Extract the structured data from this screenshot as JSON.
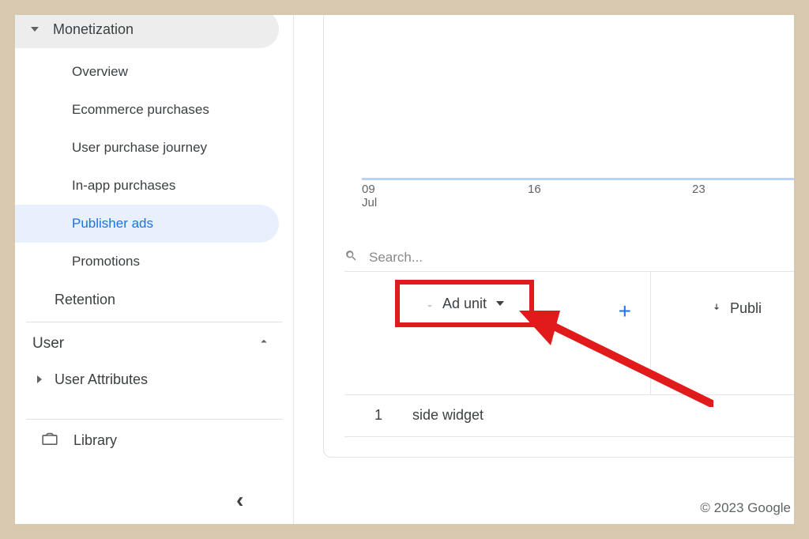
{
  "sidebar": {
    "section_title": "Monetization",
    "items": [
      "Overview",
      "Ecommerce purchases",
      "User purchase journey",
      "In-app purchases",
      "Publisher ads",
      "Promotions"
    ],
    "active_index": 4,
    "retention_label": "Retention",
    "user_label": "User",
    "user_attributes_label": "User Attributes",
    "library_label": "Library"
  },
  "chart_data": {
    "type": "line",
    "x_ticks": [
      {
        "day": "09",
        "month": "Jul"
      },
      {
        "day": "16",
        "month": ""
      },
      {
        "day": "23",
        "month": ""
      }
    ]
  },
  "main": {
    "search_placeholder": "Search...",
    "column_ad_unit": "Ad unit",
    "column_publisher_truncated": "Publi",
    "rows": [
      {
        "index": "1",
        "name": "side widget"
      }
    ]
  },
  "footer": {
    "copyright": "© 2023 Google"
  }
}
